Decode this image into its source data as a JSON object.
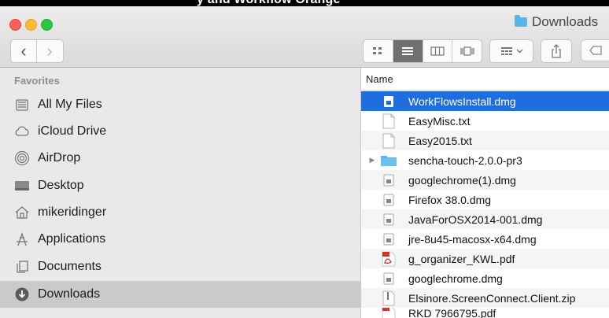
{
  "window": {
    "title": "Downloads",
    "top_crop_text": "y and Workflow Orange"
  },
  "toolbar": {
    "back_icon": "‹",
    "forward_icon": "›",
    "view_icons": [
      "icon-view-icon",
      "list-view-icon",
      "column-view-icon",
      "cover-flow-icon"
    ],
    "selected_view": "list"
  },
  "sidebar": {
    "heading": "Favorites",
    "items": [
      {
        "label": "All My Files",
        "icon": "all-files-icon"
      },
      {
        "label": "iCloud Drive",
        "icon": "cloud-icon"
      },
      {
        "label": "AirDrop",
        "icon": "airdrop-icon"
      },
      {
        "label": "Desktop",
        "icon": "desktop-icon"
      },
      {
        "label": "mikeridinger",
        "icon": "home-icon"
      },
      {
        "label": "Applications",
        "icon": "applications-icon"
      },
      {
        "label": "Documents",
        "icon": "documents-icon"
      },
      {
        "label": "Downloads",
        "icon": "downloads-icon"
      }
    ],
    "selected": "Downloads"
  },
  "file_list": {
    "column_header": "Name",
    "files": [
      {
        "name": "WorkFlowsInstall.dmg",
        "type": "dmg"
      },
      {
        "name": "EasyMisc.txt",
        "type": "txt"
      },
      {
        "name": "Easy2015.txt",
        "type": "txt"
      },
      {
        "name": "sencha-touch-2.0.0-pr3",
        "type": "folder"
      },
      {
        "name": "googlechrome(1).dmg",
        "type": "dmg"
      },
      {
        "name": "Firefox 38.0.dmg",
        "type": "dmg"
      },
      {
        "name": "JavaForOSX2014-001.dmg",
        "type": "dmg"
      },
      {
        "name": "jre-8u45-macosx-x64.dmg",
        "type": "dmg"
      },
      {
        "name": "g_organizer_KWL.pdf",
        "type": "pdf"
      },
      {
        "name": "googlechrome.dmg",
        "type": "dmg"
      },
      {
        "name": "Elsinore.ScreenConnect.Client.zip",
        "type": "zip"
      },
      {
        "name": "RKD 7966795.pdf",
        "type": "pdf"
      }
    ],
    "selected_index": 0
  },
  "colors": {
    "selection": "#1f6ee0",
    "sidebar_bg": "#e9e9eb",
    "folder": "#5ab4e8",
    "pdf": "#d8322b"
  }
}
